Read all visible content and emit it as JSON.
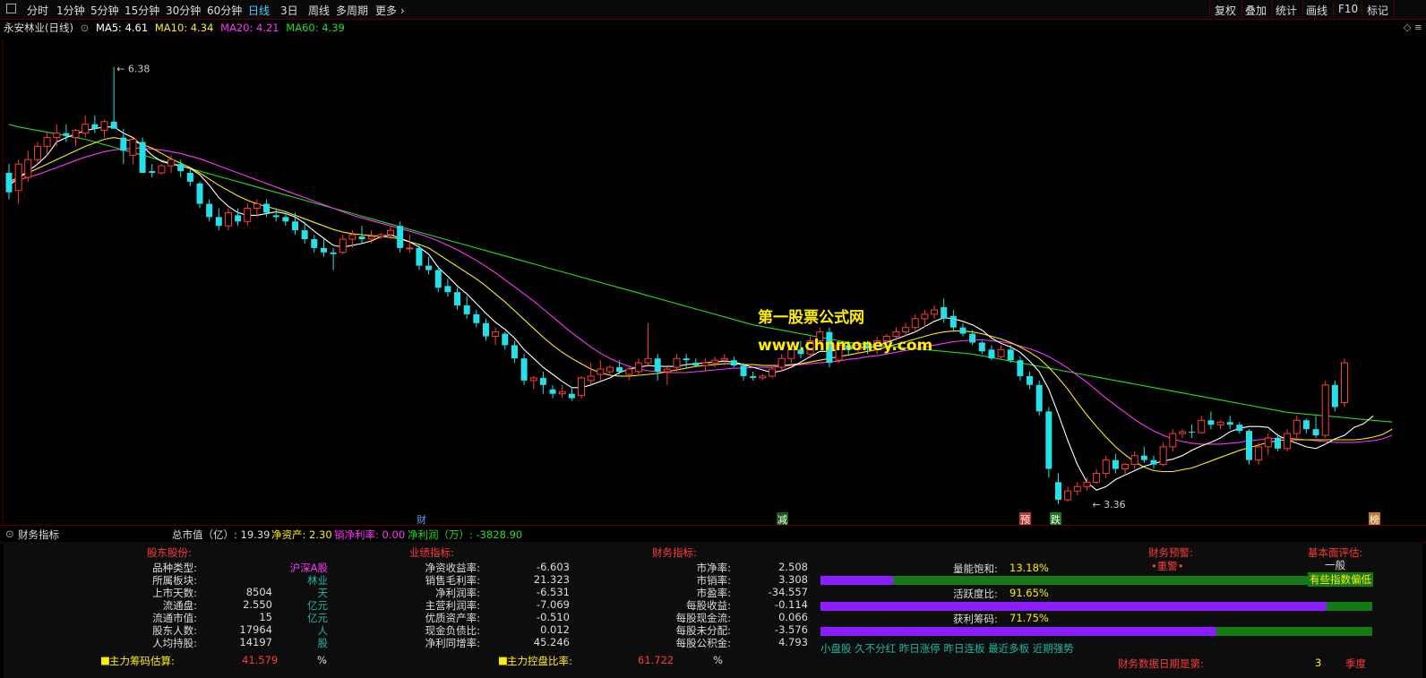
{
  "toolbar": {
    "periods": [
      "分时",
      "1分钟",
      "5分钟",
      "15分钟",
      "30分钟",
      "60分钟",
      "日线",
      "3日",
      "周线",
      "多周期",
      "更多"
    ],
    "active_period": "日线",
    "right_buttons": [
      "复权",
      "叠加",
      "统计",
      "画线",
      "F10",
      "标记"
    ]
  },
  "legend": {
    "stock": "永安林业(日线)",
    "ma5": "MA5: 4.61",
    "ma10": "MA10: 4.34",
    "ma20": "MA20: 4.21",
    "ma60": "MA60: 4.39"
  },
  "colors": {
    "up": "#ff3b3b",
    "down": "#25e0e8",
    "ma5": "#ffffff",
    "ma10": "#ffee00",
    "ma20": "#ff33ff",
    "ma60": "#22dd22",
    "watermark": "#ffee00"
  },
  "chart_annotations": {
    "high_label": "6.38",
    "low_label": "3.36"
  },
  "watermark": {
    "line1": "第一股票公式网",
    "line2": "www.chnmoney.com"
  },
  "event_markers": [
    "财",
    "减",
    "预",
    "跌",
    "榜"
  ],
  "panel_title": {
    "name": "财务指标",
    "mktcap": "总市值（亿）: 19.39",
    "netasset": "净资产: 2.30",
    "netmargin": "销净利率: 0.00",
    "netprofit": "净利润（万）: -3828.90"
  },
  "finance": {
    "holders_header": "股东股份:",
    "perf_header": "业绩指标:",
    "fin_header": "财务指标:",
    "warn_header": "财务预警:",
    "warn_value": "•重警•",
    "eval_header": "基本面评估:",
    "eval_value": "一般",
    "eval_note": "有些指数偏低",
    "holders": [
      {
        "label": "品种类型:",
        "value": "",
        "unit": "沪深A股"
      },
      {
        "label": "所属板块:",
        "value": "",
        "unit": "林业"
      },
      {
        "label": "上市天数:",
        "value": "8504",
        "unit": "天"
      },
      {
        "label": "流通盘:",
        "value": "2.550",
        "unit": "亿元"
      },
      {
        "label": "流通市值:",
        "value": "15",
        "unit": "亿元"
      },
      {
        "label": "股东人数:",
        "value": "17964",
        "unit": "人"
      },
      {
        "label": "人均持股:",
        "value": "14197",
        "unit": "股"
      }
    ],
    "perf": [
      {
        "label": "净资收益率:",
        "value": "-6.603"
      },
      {
        "label": "销售毛利率:",
        "value": "21.323"
      },
      {
        "label": "净利润率:",
        "value": "-6.531"
      },
      {
        "label": "主营利润率:",
        "value": "-7.069"
      },
      {
        "label": "优质资产率:",
        "value": "-0.510"
      },
      {
        "label": "现金负债比:",
        "value": "0.012"
      },
      {
        "label": "净利同增率:",
        "value": "45.246"
      }
    ],
    "fin": [
      {
        "label": "市净率:",
        "value": "2.508"
      },
      {
        "label": "市销率:",
        "value": "3.308"
      },
      {
        "label": "市盈率:",
        "value": "-34.557"
      },
      {
        "label": "每股收益:",
        "value": "-0.114"
      },
      {
        "label": "每股现金流:",
        "value": "0.066"
      },
      {
        "label": "每股未分配:",
        "value": "-3.576"
      },
      {
        "label": "每股公积金:",
        "value": "4.793"
      }
    ],
    "bars": [
      {
        "label": "量能饱和:",
        "value": "13.18%",
        "fraction": 0.1318
      },
      {
        "label": "活跃度比:",
        "value": "91.65%",
        "fraction": 0.9165
      },
      {
        "label": "获利筹码:",
        "value": "71.75%",
        "fraction": 0.7175
      }
    ],
    "tags": "小盘股 久不分红 昨日涨停 昨日连板 最近多板 近期强势",
    "chip_est_label": "主力筹码估算:",
    "chip_est_value": "41.579",
    "chip_est_unit": "%",
    "control_label": "主力控盘比率:",
    "control_value": "61.722",
    "control_unit": "%",
    "report_label": "财务数据日期是第:",
    "report_value": "3",
    "report_unit": "季度"
  },
  "candles": [
    [
      4.9,
      5.0,
      4.6,
      4.68
    ],
    [
      4.7,
      5.05,
      4.55,
      5.0
    ],
    [
      4.85,
      5.15,
      4.8,
      5.05
    ],
    [
      5.05,
      5.25,
      5.0,
      5.2
    ],
    [
      5.2,
      5.35,
      5.1,
      5.3
    ],
    [
      5.3,
      5.45,
      5.2,
      5.35
    ],
    [
      5.35,
      5.45,
      5.25,
      5.32
    ],
    [
      5.3,
      5.4,
      5.2,
      5.38
    ],
    [
      5.35,
      5.55,
      5.3,
      5.45
    ],
    [
      5.45,
      5.55,
      5.35,
      5.4
    ],
    [
      5.38,
      5.5,
      5.3,
      5.48
    ],
    [
      5.48,
      6.1,
      5.4,
      5.4
    ],
    [
      5.3,
      5.4,
      5.0,
      5.15
    ],
    [
      5.1,
      5.3,
      5.0,
      5.28
    ],
    [
      5.25,
      5.3,
      4.9,
      4.9
    ],
    [
      4.92,
      5.0,
      4.85,
      4.9
    ],
    [
      4.9,
      5.0,
      4.88,
      4.98
    ],
    [
      4.98,
      5.1,
      4.9,
      5.05
    ],
    [
      5.0,
      5.05,
      4.85,
      4.92
    ],
    [
      4.9,
      4.95,
      4.75,
      4.8
    ],
    [
      4.78,
      4.8,
      4.5,
      4.55
    ],
    [
      4.55,
      4.6,
      4.35,
      4.4
    ],
    [
      4.4,
      4.5,
      4.25,
      4.3
    ],
    [
      4.3,
      4.5,
      4.25,
      4.45
    ],
    [
      4.42,
      4.5,
      4.3,
      4.35
    ],
    [
      4.35,
      4.55,
      4.3,
      4.5
    ],
    [
      4.5,
      4.6,
      4.4,
      4.55
    ],
    [
      4.55,
      4.6,
      4.4,
      4.45
    ],
    [
      4.42,
      4.5,
      4.35,
      4.4
    ],
    [
      4.4,
      4.45,
      4.3,
      4.35
    ],
    [
      4.35,
      4.45,
      4.2,
      4.25
    ],
    [
      4.25,
      4.35,
      4.1,
      4.15
    ],
    [
      4.15,
      4.2,
      4.0,
      4.05
    ],
    [
      4.05,
      4.15,
      3.95,
      4.0
    ],
    [
      4.0,
      4.05,
      3.8,
      3.98
    ],
    [
      4.0,
      4.2,
      3.98,
      4.15
    ],
    [
      4.15,
      4.25,
      4.05,
      4.2
    ],
    [
      4.18,
      4.3,
      4.1,
      4.15
    ],
    [
      4.15,
      4.25,
      4.1,
      4.18
    ],
    [
      4.18,
      4.22,
      4.15,
      4.2
    ],
    [
      4.2,
      4.3,
      4.15,
      4.25
    ],
    [
      4.3,
      4.35,
      4.0,
      4.05
    ],
    [
      4.05,
      4.2,
      4.0,
      4.05
    ],
    [
      4.05,
      4.1,
      3.8,
      3.85
    ],
    [
      3.85,
      3.95,
      3.75,
      3.8
    ],
    [
      3.8,
      3.85,
      3.55,
      3.6
    ],
    [
      3.62,
      3.7,
      3.5,
      3.55
    ],
    [
      3.55,
      3.6,
      3.35,
      3.4
    ],
    [
      3.4,
      3.5,
      3.25,
      3.3
    ],
    [
      3.3,
      3.35,
      3.15,
      3.2
    ],
    [
      3.2,
      3.25,
      3.0,
      3.05
    ],
    [
      3.05,
      3.15,
      2.95,
      3.1
    ],
    [
      3.08,
      3.1,
      2.9,
      2.95
    ],
    [
      2.95,
      3.0,
      2.75,
      2.8
    ],
    [
      2.8,
      2.85,
      2.5,
      2.55
    ],
    [
      2.55,
      2.6,
      2.45,
      2.58
    ],
    [
      2.58,
      2.65,
      2.4,
      2.5
    ],
    [
      2.45,
      2.5,
      2.35,
      2.4
    ],
    [
      2.4,
      2.5,
      2.35,
      2.42
    ],
    [
      2.4,
      2.48,
      2.32,
      2.35
    ],
    [
      2.38,
      2.6,
      2.35,
      2.58
    ],
    [
      2.55,
      2.75,
      2.5,
      2.6
    ],
    [
      2.62,
      2.78,
      2.55,
      2.68
    ],
    [
      2.65,
      2.72,
      2.6,
      2.7
    ],
    [
      2.7,
      2.78,
      2.62,
      2.65
    ],
    [
      2.62,
      2.7,
      2.55,
      2.68
    ],
    [
      2.65,
      2.8,
      2.6,
      2.75
    ],
    [
      2.75,
      3.2,
      2.7,
      2.8
    ],
    [
      2.8,
      2.85,
      2.55,
      2.65
    ],
    [
      2.65,
      2.7,
      2.5,
      2.68
    ],
    [
      2.7,
      2.85,
      2.65,
      2.8
    ],
    [
      2.8,
      2.85,
      2.7,
      2.78
    ],
    [
      2.75,
      2.8,
      2.7,
      2.72
    ],
    [
      2.72,
      2.8,
      2.65,
      2.75
    ],
    [
      2.75,
      2.82,
      2.7,
      2.78
    ],
    [
      2.78,
      2.85,
      2.72,
      2.8
    ],
    [
      2.78,
      2.82,
      2.7,
      2.72
    ],
    [
      2.72,
      2.75,
      2.55,
      2.6
    ],
    [
      2.6,
      2.65,
      2.55,
      2.58
    ],
    [
      2.58,
      2.62,
      2.55,
      2.6
    ],
    [
      2.6,
      2.7,
      2.58,
      2.68
    ],
    [
      2.7,
      2.85,
      2.65,
      2.8
    ],
    [
      2.8,
      2.95,
      2.75,
      2.9
    ],
    [
      2.9,
      3.0,
      2.8,
      2.85
    ],
    [
      2.85,
      3.05,
      2.8,
      3.0
    ],
    [
      3.0,
      3.15,
      2.95,
      3.1
    ],
    [
      3.1,
      3.15,
      2.7,
      2.75
    ],
    [
      2.78,
      3.0,
      2.75,
      2.95
    ],
    [
      2.95,
      3.0,
      2.85,
      2.9
    ],
    [
      2.9,
      3.0,
      2.85,
      2.95
    ],
    [
      2.95,
      3.0,
      2.85,
      2.92
    ],
    [
      2.9,
      3.05,
      2.85,
      3.0
    ],
    [
      3.0,
      3.08,
      2.95,
      3.05
    ],
    [
      3.05,
      3.15,
      3.0,
      3.1
    ],
    [
      3.1,
      3.2,
      3.05,
      3.15
    ],
    [
      3.15,
      3.3,
      3.1,
      3.25
    ],
    [
      3.25,
      3.35,
      3.15,
      3.3
    ],
    [
      3.3,
      3.4,
      3.25,
      3.35
    ],
    [
      3.38,
      3.48,
      3.2,
      3.25
    ],
    [
      3.28,
      3.35,
      3.1,
      3.15
    ],
    [
      3.15,
      3.2,
      3.05,
      3.08
    ],
    [
      3.08,
      3.12,
      2.95,
      2.98
    ],
    [
      2.98,
      3.0,
      2.85,
      2.88
    ],
    [
      2.9,
      2.95,
      2.78,
      2.8
    ],
    [
      2.82,
      2.95,
      2.8,
      2.9
    ],
    [
      2.9,
      2.95,
      2.75,
      2.78
    ],
    [
      2.78,
      2.82,
      2.55,
      2.6
    ],
    [
      2.6,
      2.65,
      2.45,
      2.5
    ],
    [
      2.5,
      2.55,
      2.15,
      2.2
    ],
    [
      2.2,
      2.25,
      1.45,
      1.55
    ],
    [
      1.4,
      1.5,
      1.15,
      1.2
    ],
    [
      1.2,
      1.35,
      1.18,
      1.3
    ],
    [
      1.3,
      1.4,
      1.25,
      1.35
    ],
    [
      1.35,
      1.45,
      1.3,
      1.4
    ],
    [
      1.4,
      1.55,
      1.38,
      1.5
    ],
    [
      1.5,
      1.7,
      1.45,
      1.65
    ],
    [
      1.65,
      1.72,
      1.5,
      1.55
    ],
    [
      1.55,
      1.62,
      1.48,
      1.6
    ],
    [
      1.6,
      1.75,
      1.55,
      1.7
    ],
    [
      1.7,
      1.8,
      1.62,
      1.65
    ],
    [
      1.65,
      1.7,
      1.55,
      1.6
    ],
    [
      1.6,
      1.85,
      1.58,
      1.8
    ],
    [
      1.8,
      2.0,
      1.75,
      1.95
    ],
    [
      1.95,
      2.0,
      1.9,
      1.97
    ],
    [
      1.97,
      2.05,
      1.9,
      1.96
    ],
    [
      1.96,
      2.15,
      1.95,
      2.1
    ],
    [
      2.1,
      2.2,
      2.0,
      2.05
    ],
    [
      2.05,
      2.1,
      2.0,
      2.08
    ],
    [
      2.08,
      2.15,
      2.0,
      2.05
    ],
    [
      2.05,
      2.08,
      1.95,
      1.98
    ],
    [
      1.98,
      2.0,
      1.6,
      1.65
    ],
    [
      1.65,
      1.85,
      1.6,
      1.8
    ],
    [
      1.8,
      1.95,
      1.7,
      1.9
    ],
    [
      1.9,
      1.95,
      1.75,
      1.78
    ],
    [
      1.78,
      2.0,
      1.75,
      1.95
    ],
    [
      1.95,
      2.15,
      1.9,
      2.1
    ],
    [
      2.1,
      2.12,
      1.95,
      2.0
    ],
    [
      2.0,
      2.15,
      1.9,
      1.93
    ],
    [
      1.93,
      2.55,
      1.9,
      2.5
    ],
    [
      2.5,
      2.55,
      2.2,
      2.25
    ],
    [
      2.3,
      2.8,
      2.25,
      2.75
    ]
  ],
  "ma5": [
    4.75,
    4.85,
    4.92,
    5.0,
    5.1,
    5.25,
    5.3,
    5.34,
    5.38,
    5.4,
    5.42,
    5.42,
    5.35,
    5.3,
    5.2,
    5.1,
    5.03,
    5.0,
    4.98,
    4.95,
    4.88,
    4.76,
    4.62,
    4.52,
    4.45,
    4.42,
    4.42,
    4.44,
    4.46,
    4.44,
    4.4,
    4.33,
    4.24,
    4.16,
    4.08,
    4.06,
    4.08,
    4.1,
    4.13,
    4.18,
    4.2,
    4.16,
    4.12,
    4.06,
    3.98,
    3.83,
    3.73,
    3.62,
    3.53,
    3.42,
    3.31,
    3.21,
    3.13,
    3.03,
    2.9,
    2.8,
    2.7,
    2.62,
    2.54,
    2.47,
    2.47,
    2.5,
    2.54,
    2.58,
    2.64,
    2.68,
    2.7,
    2.72,
    2.71,
    2.71,
    2.71,
    2.73,
    2.74,
    2.75,
    2.76,
    2.77,
    2.76,
    2.73,
    2.7,
    2.67,
    2.64,
    2.66,
    2.7,
    2.76,
    2.82,
    2.88,
    2.88,
    2.9,
    2.91,
    2.93,
    2.92,
    2.94,
    2.98,
    3.02,
    3.06,
    3.1,
    3.16,
    3.22,
    3.26,
    3.25,
    3.22,
    3.18,
    3.12,
    3.03,
    2.97,
    2.93,
    2.87,
    2.77,
    2.65,
    2.45,
    2.17,
    1.87,
    1.6,
    1.4,
    1.31,
    1.35,
    1.43,
    1.48,
    1.53,
    1.58,
    1.61,
    1.64,
    1.66,
    1.7,
    1.76,
    1.81,
    1.85,
    1.9,
    1.97,
    2.01,
    2.03,
    2.03,
    2.02,
    1.93,
    1.88,
    1.84,
    1.8,
    1.78,
    1.83,
    1.89,
    1.93,
    2.02,
    2.06,
    2.15
  ],
  "ma10": [
    4.8,
    4.85,
    4.9,
    4.95,
    5.0,
    5.05,
    5.1,
    5.15,
    5.2,
    5.24,
    5.28,
    5.3,
    5.28,
    5.26,
    5.22,
    5.18,
    5.12,
    5.06,
    5.01,
    4.96,
    4.9,
    4.83,
    4.76,
    4.7,
    4.64,
    4.59,
    4.55,
    4.52,
    4.49,
    4.46,
    4.42,
    4.38,
    4.34,
    4.3,
    4.26,
    4.23,
    4.21,
    4.2,
    4.19,
    4.18,
    4.17,
    4.15,
    4.12,
    4.09,
    4.05,
    3.98,
    3.91,
    3.84,
    3.77,
    3.7,
    3.62,
    3.53,
    3.44,
    3.34,
    3.24,
    3.14,
    3.04,
    2.95,
    2.87,
    2.8,
    2.74,
    2.68,
    2.64,
    2.61,
    2.6,
    2.6,
    2.61,
    2.62,
    2.63,
    2.65,
    2.67,
    2.69,
    2.71,
    2.72,
    2.73,
    2.74,
    2.74,
    2.73,
    2.73,
    2.72,
    2.72,
    2.72,
    2.73,
    2.74,
    2.76,
    2.78,
    2.8,
    2.82,
    2.84,
    2.86,
    2.88,
    2.9,
    2.93,
    2.96,
    2.99,
    3.02,
    3.05,
    3.08,
    3.1,
    3.11,
    3.11,
    3.1,
    3.08,
    3.05,
    3.02,
    2.98,
    2.93,
    2.87,
    2.8,
    2.7,
    2.58,
    2.45,
    2.3,
    2.16,
    2.03,
    1.91,
    1.8,
    1.71,
    1.63,
    1.57,
    1.53,
    1.52,
    1.52,
    1.54,
    1.56,
    1.6,
    1.64,
    1.68,
    1.72,
    1.76,
    1.79,
    1.82,
    1.85,
    1.87,
    1.88,
    1.88,
    1.88,
    1.88,
    1.88,
    1.88,
    1.88,
    1.88,
    1.89,
    1.91,
    1.94,
    2.0
  ],
  "ma20": [
    4.8,
    4.82,
    4.85,
    4.88,
    4.92,
    4.96,
    5.0,
    5.04,
    5.08,
    5.11,
    5.14,
    5.16,
    5.17,
    5.18,
    5.18,
    5.17,
    5.16,
    5.14,
    5.12,
    5.09,
    5.06,
    5.02,
    4.98,
    4.94,
    4.9,
    4.86,
    4.82,
    4.78,
    4.74,
    4.7,
    4.66,
    4.62,
    4.58,
    4.54,
    4.5,
    4.46,
    4.42,
    4.39,
    4.36,
    4.33,
    4.3,
    4.27,
    4.24,
    4.21,
    4.17,
    4.13,
    4.08,
    4.03,
    3.97,
    3.91,
    3.84,
    3.77,
    3.69,
    3.61,
    3.53,
    3.45,
    3.36,
    3.27,
    3.18,
    3.09,
    3.01,
    2.93,
    2.86,
    2.8,
    2.75,
    2.71,
    2.68,
    2.66,
    2.65,
    2.64,
    2.64,
    2.64,
    2.65,
    2.66,
    2.67,
    2.68,
    2.69,
    2.69,
    2.7,
    2.7,
    2.7,
    2.71,
    2.72,
    2.73,
    2.74,
    2.75,
    2.76,
    2.77,
    2.79,
    2.8,
    2.82,
    2.83,
    2.85,
    2.87,
    2.89,
    2.91,
    2.93,
    2.95,
    2.97,
    2.99,
    3.0,
    3.01,
    3.01,
    3.0,
    2.99,
    2.97,
    2.94,
    2.91,
    2.87,
    2.82,
    2.76,
    2.69,
    2.61,
    2.53,
    2.44,
    2.35,
    2.27,
    2.19,
    2.11,
    2.04,
    1.98,
    1.93,
    1.89,
    1.86,
    1.84,
    1.83,
    1.83,
    1.83,
    1.84,
    1.85,
    1.87,
    1.88,
    1.89,
    1.9,
    1.9,
    1.89,
    1.88,
    1.87,
    1.86,
    1.85,
    1.85,
    1.85,
    1.86,
    1.87,
    1.89,
    1.93
  ],
  "ma60": [
    5.45,
    5.42,
    5.4,
    5.38,
    5.36,
    5.34,
    5.32,
    5.3,
    5.28,
    5.25,
    5.22,
    5.19,
    5.16,
    5.13,
    5.1,
    5.07,
    5.04,
    5.01,
    4.98,
    4.95,
    4.92,
    4.89,
    4.86,
    4.83,
    4.8,
    4.77,
    4.74,
    4.71,
    4.68,
    4.65,
    4.62,
    4.59,
    4.56,
    4.53,
    4.5,
    4.47,
    4.44,
    4.41,
    4.38,
    4.35,
    4.32,
    4.29,
    4.26,
    4.23,
    4.2,
    4.17,
    4.14,
    4.11,
    4.08,
    4.05,
    4.02,
    3.99,
    3.96,
    3.93,
    3.9,
    3.87,
    3.84,
    3.81,
    3.78,
    3.75,
    3.72,
    3.69,
    3.66,
    3.63,
    3.6,
    3.57,
    3.54,
    3.51,
    3.48,
    3.45,
    3.42,
    3.39,
    3.36,
    3.33,
    3.3,
    3.27,
    3.24,
    3.21,
    3.18,
    3.16,
    3.14,
    3.12,
    3.1,
    3.08,
    3.06,
    3.04,
    3.02,
    3.0,
    2.98,
    2.97,
    2.96,
    2.95,
    2.94,
    2.93,
    2.92,
    2.91,
    2.9,
    2.89,
    2.88,
    2.87,
    2.86,
    2.85,
    2.83,
    2.81,
    2.79,
    2.77,
    2.75,
    2.73,
    2.71,
    2.69,
    2.67,
    2.65,
    2.63,
    2.61,
    2.59,
    2.57,
    2.55,
    2.53,
    2.51,
    2.49,
    2.47,
    2.45,
    2.43,
    2.41,
    2.39,
    2.37,
    2.35,
    2.33,
    2.31,
    2.29,
    2.27,
    2.25,
    2.23,
    2.21,
    2.19,
    2.18,
    2.17,
    2.16,
    2.15,
    2.14,
    2.13,
    2.12,
    2.11,
    2.1,
    2.09,
    2.08
  ]
}
